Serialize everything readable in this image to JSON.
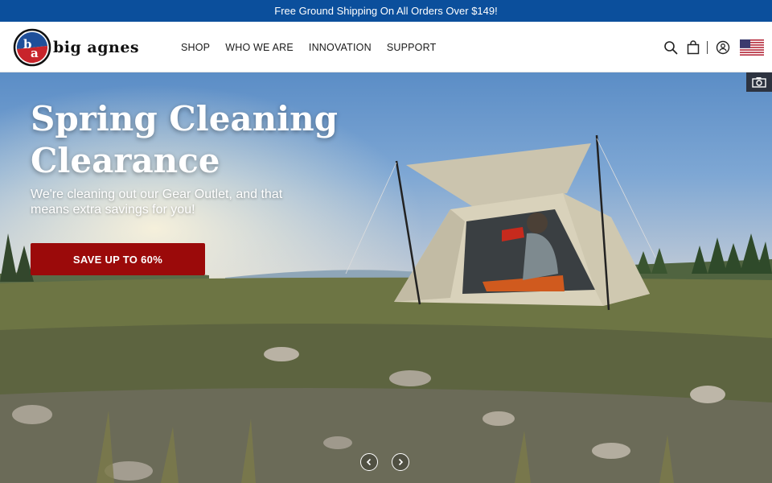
{
  "promo": {
    "text": "Free Ground Shipping On All Orders Over $149!"
  },
  "brand": {
    "name": "big agnes"
  },
  "nav": {
    "items": [
      {
        "label": "SHOP"
      },
      {
        "label": "WHO WE ARE"
      },
      {
        "label": "INNOVATION"
      },
      {
        "label": "SUPPORT"
      }
    ]
  },
  "utilities": {
    "icons": [
      "search-icon",
      "cart-icon",
      "account-icon",
      "us-flag-icon"
    ]
  },
  "hero": {
    "title": "Spring Cleaning Clearance",
    "subtitle": "We're cleaning out our Gear Outlet, and that means extra savings for you!",
    "cta_label": "SAVE UP TO 60%",
    "camera_icon": "camera-icon"
  },
  "carousel": {
    "prev_icon": "chevron-left-icon",
    "next_icon": "chevron-right-icon"
  },
  "colors": {
    "promo_bg": "#0b4f9c",
    "cta_bg": "#9b0a0a",
    "logo_red": "#c8242b",
    "logo_blue": "#1f4f9a"
  }
}
